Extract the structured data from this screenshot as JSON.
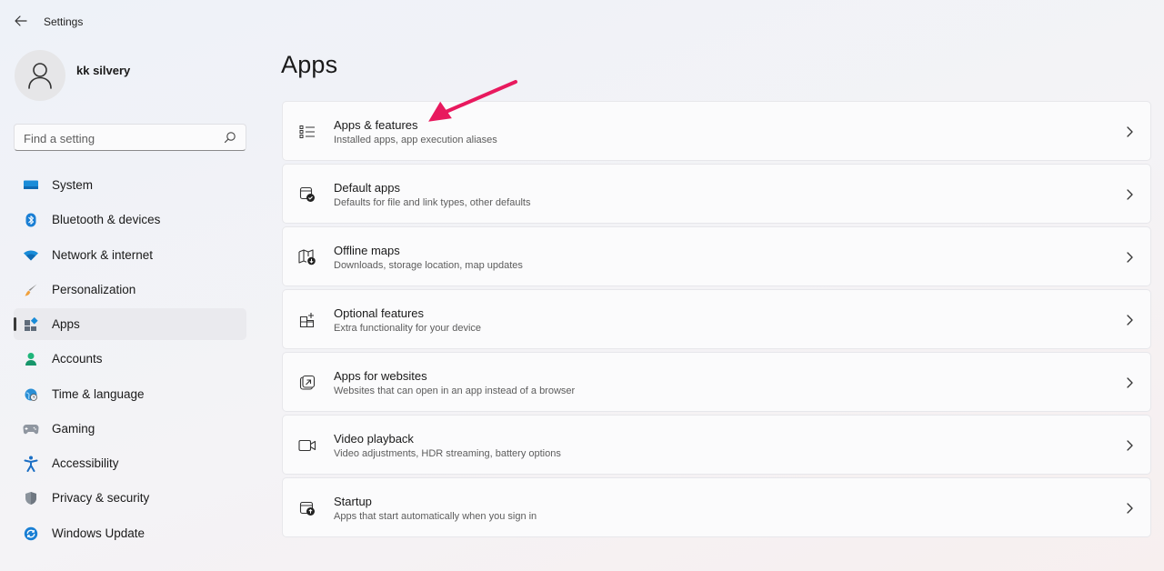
{
  "window": {
    "title": "Settings"
  },
  "user": {
    "name": "kk silvery"
  },
  "search": {
    "placeholder": "Find a setting"
  },
  "sidebar": {
    "items": [
      {
        "label": "System",
        "icon": "system-icon",
        "selected": false
      },
      {
        "label": "Bluetooth & devices",
        "icon": "bluetooth-icon",
        "selected": false
      },
      {
        "label": "Network & internet",
        "icon": "wifi-icon",
        "selected": false
      },
      {
        "label": "Personalization",
        "icon": "brush-icon",
        "selected": false
      },
      {
        "label": "Apps",
        "icon": "apps-icon",
        "selected": true
      },
      {
        "label": "Accounts",
        "icon": "person-icon",
        "selected": false
      },
      {
        "label": "Time & language",
        "icon": "globe-clock-icon",
        "selected": false
      },
      {
        "label": "Gaming",
        "icon": "gamepad-icon",
        "selected": false
      },
      {
        "label": "Accessibility",
        "icon": "accessibility-icon",
        "selected": false
      },
      {
        "label": "Privacy & security",
        "icon": "shield-icon",
        "selected": false
      },
      {
        "label": "Windows Update",
        "icon": "update-icon",
        "selected": false
      }
    ]
  },
  "main": {
    "title": "Apps",
    "cards": [
      {
        "title": "Apps & features",
        "subtitle": "Installed apps, app execution aliases",
        "icon": "list-icon"
      },
      {
        "title": "Default apps",
        "subtitle": "Defaults for file and link types, other defaults",
        "icon": "default-apps-icon"
      },
      {
        "title": "Offline maps",
        "subtitle": "Downloads, storage location, map updates",
        "icon": "map-download-icon"
      },
      {
        "title": "Optional features",
        "subtitle": "Extra functionality for your device",
        "icon": "add-grid-icon"
      },
      {
        "title": "Apps for websites",
        "subtitle": "Websites that can open in an app instead of a browser",
        "icon": "open-in-app-icon"
      },
      {
        "title": "Video playback",
        "subtitle": "Video adjustments, HDR streaming, battery options",
        "icon": "video-icon"
      },
      {
        "title": "Startup",
        "subtitle": "Apps that start automatically when you sign in",
        "icon": "startup-icon"
      }
    ]
  },
  "colors": {
    "annotation_arrow": "#e8195e",
    "accent_blue": "#0067c0",
    "selected_bg": "#eaeaee"
  }
}
